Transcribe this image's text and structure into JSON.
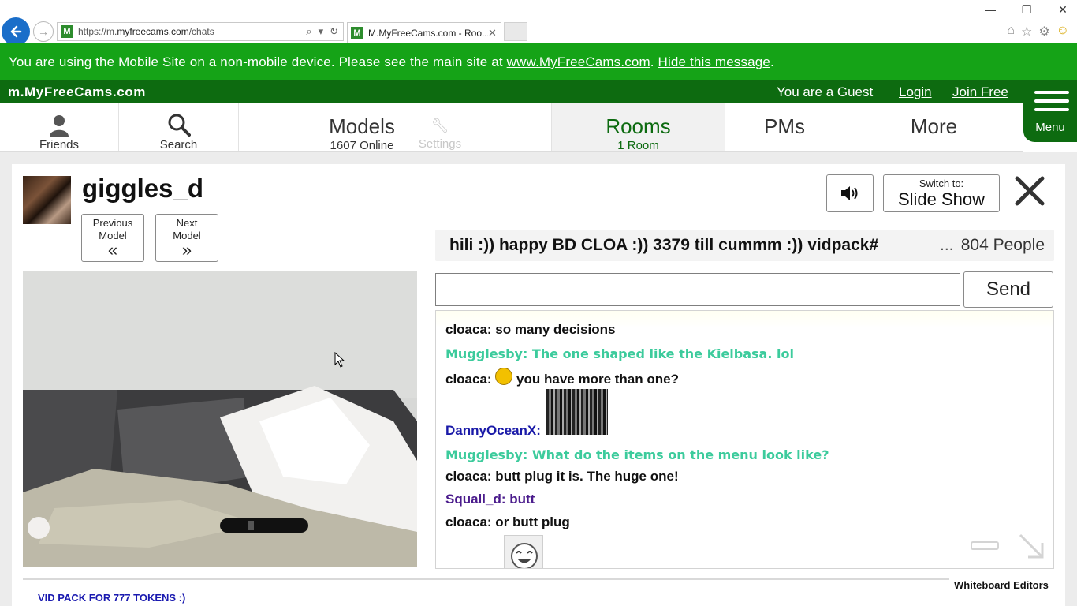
{
  "browser": {
    "url_prefix": "https://m.",
    "url_domain": "myfreecams.com",
    "url_path": "/chats",
    "tab_title": "M.MyFreeCams.com - Roo...",
    "favicon_letter": "M"
  },
  "notice": {
    "text": "You are using the Mobile Site on a non-mobile device. Please see the main site at ",
    "link_main": "www.MyFreeCams.com",
    "sep": ". ",
    "link_hide": "Hide this message",
    "end": "."
  },
  "header": {
    "logo": "m.MyFreeCams.com",
    "guest": "You are a Guest",
    "login": "Login",
    "join": "Join Free",
    "menu": "Menu"
  },
  "nav": {
    "friends": "Friends",
    "search": "Search",
    "models": "Models",
    "models_count": "1607 Online",
    "settings": "Settings",
    "rooms": "Rooms",
    "rooms_count": "1 Room",
    "pms": "PMs",
    "more": "More"
  },
  "room": {
    "model_name": "giggles_d",
    "prev_label_1": "Previous",
    "prev_label_2": "Model",
    "next_label_1": "Next",
    "next_label_2": "Model",
    "switch_label": "Switch to:",
    "switch_value": "Slide Show",
    "topic": "hili :)) happy BD CLOA :)) 3379 till cummm :)) vidpack#",
    "topic_ellipsis": "...",
    "people": "804 People",
    "send": "Send",
    "vid_pack": "VID PACK FOR 777 TOKENS :)",
    "whiteboard": "Whiteboard Editors"
  },
  "chat": {
    "m1": "cloaca: so many decisions",
    "m2": "Mugglesby: The one shaped like the Kielbasa. lol",
    "m3_name": "cloaca: ",
    "m3_text": " you have more than one?",
    "m4_name": "DannyOceanX:",
    "m5": "Mugglesby: What do the items on the menu look like?",
    "m6": "cloaca: butt plug it is. The huge one!",
    "m7": "Squall_d: butt",
    "m8": "cloaca: or butt plug"
  },
  "colors": {
    "notice_green": "#15a317",
    "header_green": "#0d6b10",
    "teal_user": "#3ccb9c",
    "blue_user": "#1a1aa8",
    "purple_user": "#4a1b8c"
  }
}
